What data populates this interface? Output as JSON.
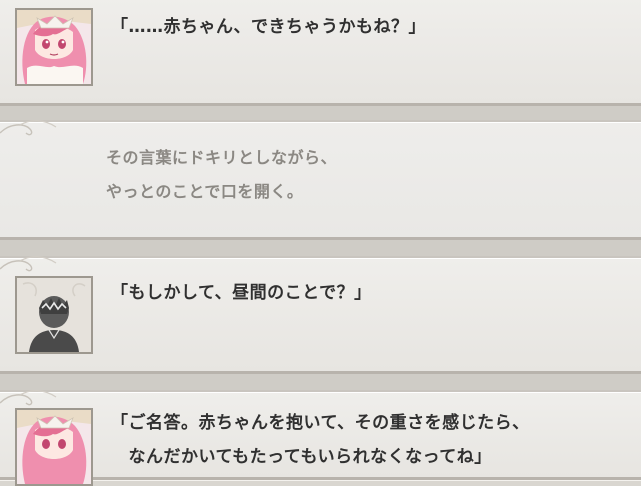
{
  "log": [
    {
      "speaker_icon": "heroine-portrait-icon",
      "lines": [
        "「……赤ちゃん、できちゃうかもね？」"
      ]
    },
    {
      "speaker_icon": null,
      "lines": [
        "その言葉にドキリとしながら、",
        "やっとのことで口を開く。"
      ]
    },
    {
      "speaker_icon": "protagonist-silhouette-icon",
      "lines": [
        "「もしかして、昼間のことで？」"
      ]
    },
    {
      "speaker_icon": "heroine-portrait-icon",
      "lines": [
        "「ご名答。赤ちゃんを抱いて、その重さを感じたら、",
        "　なんだかいてもたってもいられなくなってね」"
      ]
    }
  ],
  "colors": {
    "panel": "#ecebe8",
    "dialogue_text": "#303030",
    "narration_text": "#8b8883",
    "portrait_border": "#9d988f"
  }
}
